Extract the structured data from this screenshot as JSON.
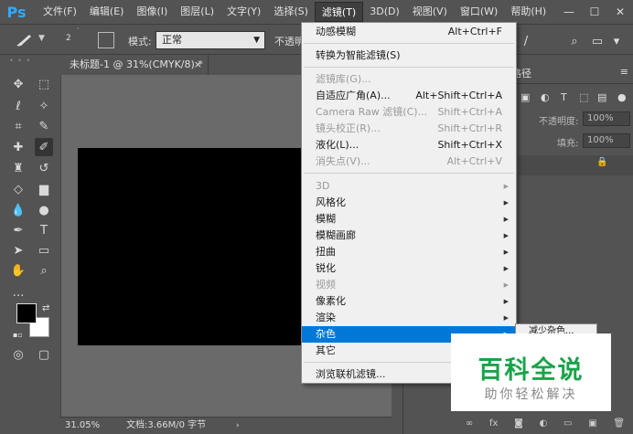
{
  "app": {
    "logo": "Ps"
  },
  "menubar": {
    "items": [
      "文件(F)",
      "编辑(E)",
      "图像(I)",
      "图层(L)",
      "文字(Y)",
      "选择(S)",
      "滤镜(T)",
      "3D(D)",
      "视图(V)",
      "窗口(W)",
      "帮助(H)"
    ],
    "active_index": 6
  },
  "window_controls": {
    "minimize": "—",
    "maximize": "☐",
    "close": "✕"
  },
  "options_bar": {
    "brush_size": "2",
    "mode_label": "模式:",
    "mode_value": "正常",
    "opacity_label": "不透明"
  },
  "document": {
    "tab_title": "未标题-1 @ 31%(CMYK/8) *",
    "tab_close": "×",
    "canvas_color": "#000000"
  },
  "statusbar": {
    "zoom": "31.05%",
    "doc_info": "文档:3.66M/0 字节",
    "caret": "›"
  },
  "right_panel": {
    "tab_label": "路径",
    "opacity_label": "不透明度:",
    "opacity_value": "100%",
    "fill_label": "填充:",
    "fill_value": "100%"
  },
  "filter_menu": {
    "items": [
      {
        "label": "动感模糊",
        "shortcut": "Alt+Ctrl+F",
        "disabled": false,
        "submenu": false
      },
      {
        "label": "转换为智能滤镜(S)",
        "shortcut": "",
        "disabled": false,
        "submenu": false
      },
      {
        "label": "滤镜库(G)...",
        "shortcut": "",
        "disabled": true,
        "submenu": false
      },
      {
        "label": "自适应广角(A)...",
        "shortcut": "Alt+Shift+Ctrl+A",
        "disabled": false,
        "submenu": false
      },
      {
        "label": "Camera Raw 滤镜(C)...",
        "shortcut": "Shift+Ctrl+A",
        "disabled": true,
        "submenu": false
      },
      {
        "label": "镜头校正(R)...",
        "shortcut": "Shift+Ctrl+R",
        "disabled": true,
        "submenu": false
      },
      {
        "label": "液化(L)...",
        "shortcut": "Shift+Ctrl+X",
        "disabled": false,
        "submenu": false
      },
      {
        "label": "消失点(V)...",
        "shortcut": "Alt+Ctrl+V",
        "disabled": true,
        "submenu": false
      },
      {
        "label": "3D",
        "shortcut": "",
        "disabled": true,
        "submenu": true
      },
      {
        "label": "风格化",
        "shortcut": "",
        "disabled": false,
        "submenu": true
      },
      {
        "label": "模糊",
        "shortcut": "",
        "disabled": false,
        "submenu": true
      },
      {
        "label": "模糊画廊",
        "shortcut": "",
        "disabled": false,
        "submenu": true
      },
      {
        "label": "扭曲",
        "shortcut": "",
        "disabled": false,
        "submenu": true
      },
      {
        "label": "锐化",
        "shortcut": "",
        "disabled": false,
        "submenu": true
      },
      {
        "label": "视频",
        "shortcut": "",
        "disabled": true,
        "submenu": true
      },
      {
        "label": "像素化",
        "shortcut": "",
        "disabled": false,
        "submenu": true
      },
      {
        "label": "渲染",
        "shortcut": "",
        "disabled": false,
        "submenu": true
      },
      {
        "label": "杂色",
        "shortcut": "",
        "disabled": false,
        "submenu": true,
        "highlighted": true
      },
      {
        "label": "其它",
        "shortcut": "",
        "disabled": false,
        "submenu": true
      },
      {
        "label": "浏览联机滤镜...",
        "shortcut": "",
        "disabled": false,
        "submenu": false
      }
    ],
    "submenu_first_item": "减少杂色..."
  },
  "watermark": {
    "title": "百科全说",
    "subtitle": "助你轻松解决"
  },
  "colors": {
    "accent": "#0078d7",
    "logo_blue": "#31a8ff",
    "watermark_green": "#1aa34a"
  }
}
